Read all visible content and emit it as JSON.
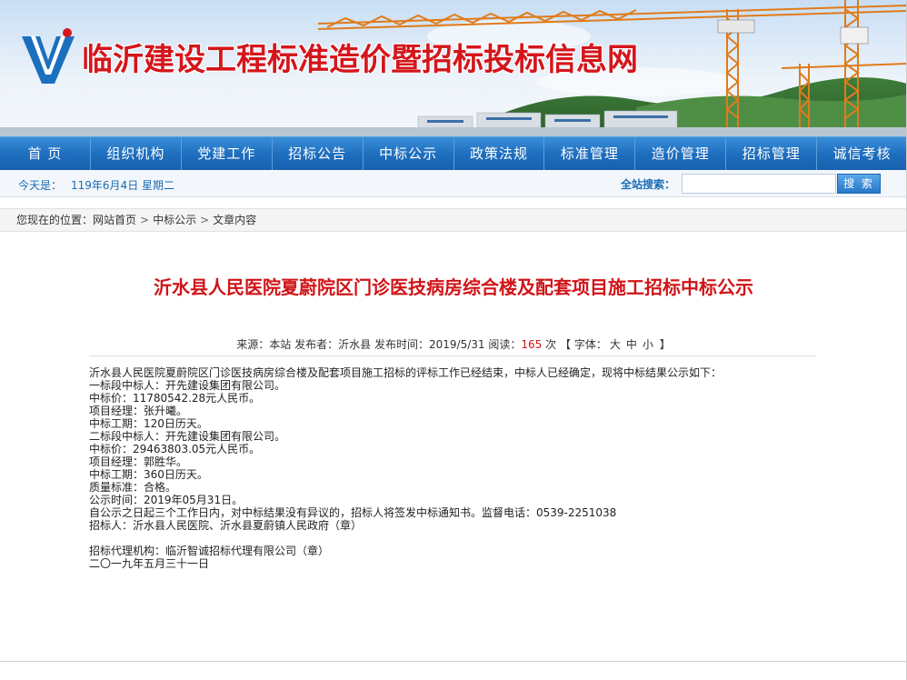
{
  "header": {
    "site_title": "临沂建设工程标准造价暨招标投标信息网",
    "logo_icon": "v-logo-icon"
  },
  "nav": [
    {
      "label": "首 页"
    },
    {
      "label": "组织机构"
    },
    {
      "label": "党建工作"
    },
    {
      "label": "招标公告"
    },
    {
      "label": "中标公示"
    },
    {
      "label": "政策法规"
    },
    {
      "label": "标准管理"
    },
    {
      "label": "造价管理"
    },
    {
      "label": "招标管理"
    },
    {
      "label": "诚信考核"
    }
  ],
  "infobar": {
    "today_label": "今天是：",
    "today_date": "119年6月4日 星期二",
    "search_label": "全站搜索：",
    "search_value": "",
    "search_button": "搜 索"
  },
  "breadcrumb": {
    "prefix": "您现在的位置：",
    "items": [
      "网站首页",
      "中标公示",
      "文章内容"
    ],
    "separator": ">"
  },
  "article": {
    "title": "沂水县人民医院夏蔚院区门诊医技病房综合楼及配套项目施工招标中标公示",
    "meta": {
      "source_label": "来源：",
      "source": "本站",
      "publisher_label": "发布者：",
      "publisher": "沂水县",
      "time_label": "发布时间：",
      "time": "2019/5/31",
      "reads_label": "阅读：",
      "reads": "165",
      "reads_unit": "次",
      "font_open": "【",
      "font_label": "字体：",
      "font_large": "大",
      "font_medium": "中",
      "font_small": "小",
      "font_close": "】"
    },
    "lines": [
      "沂水县人民医院夏蔚院区门诊医技病房综合楼及配套项目施工招标的评标工作已经结束，中标人已经确定，现将中标结果公示如下：",
      "一标段中标人：开先建设集团有限公司。",
      "中标价：11780542.28元人民币。",
      "项目经理：张升曦。",
      "中标工期：120日历天。",
      "二标段中标人：开先建设集团有限公司。",
      "中标价：29463803.05元人民币。",
      "项目经理：郭胜华。",
      "中标工期：360日历天。",
      "质量标准：合格。",
      "公示时间：2019年05月31日。",
      "自公示之日起三个工作日内，对中标结果没有异议的，招标人将签发中标通知书。监督电话：0539-2251038",
      "招标人：沂水县人民医院、沂水县夏蔚镇人民政府（章）",
      "",
      "招标代理机构：临沂智诚招标代理有限公司（章）",
      "二〇一九年五月三十一日"
    ]
  }
}
